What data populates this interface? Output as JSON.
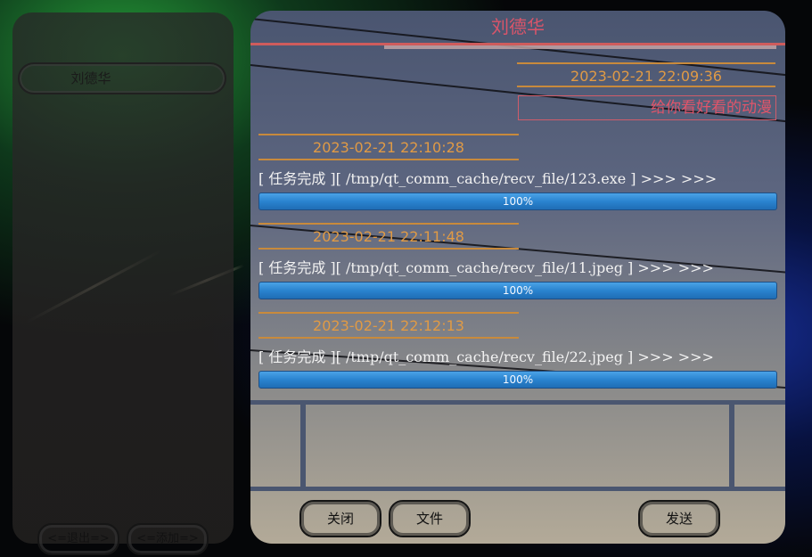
{
  "sidebar": {
    "contact_name": "刘德华",
    "exit_label": "<=退出=>",
    "add_label": "<=添加=>"
  },
  "chat": {
    "title": "刘德华",
    "messages": [
      {
        "side": "right",
        "timestamp": "2023-02-21 22:09:36",
        "text": "给你看好看的动漫"
      },
      {
        "side": "left",
        "timestamp": "2023-02-21 22:10:28",
        "file_line": "[  任务完成  ][  /tmp/qt_comm_cache/recv_file/123.exe  ]  >>>  >>>",
        "progress": 100,
        "progress_text": "100%"
      },
      {
        "side": "left",
        "timestamp": "2023-02-21 22:11:48",
        "file_line": "[  任务完成  ][  /tmp/qt_comm_cache/recv_file/11.jpeg  ]  >>>  >>>",
        "progress": 100,
        "progress_text": "100%"
      },
      {
        "side": "left",
        "timestamp": "2023-02-21 22:12:13",
        "file_line": "[  任务完成  ][  /tmp/qt_comm_cache/recv_file/22.jpeg  ]  >>>  >>>",
        "progress": 100,
        "progress_text": "100%"
      }
    ],
    "input": {
      "value": ""
    },
    "buttons": {
      "close": "关闭",
      "file": "文件",
      "send": "发送"
    }
  },
  "colors": {
    "title": "#d9556a",
    "timestamp": "#e09a45",
    "progress": "#2a83cf",
    "accent_line": "#cf5c5c"
  }
}
